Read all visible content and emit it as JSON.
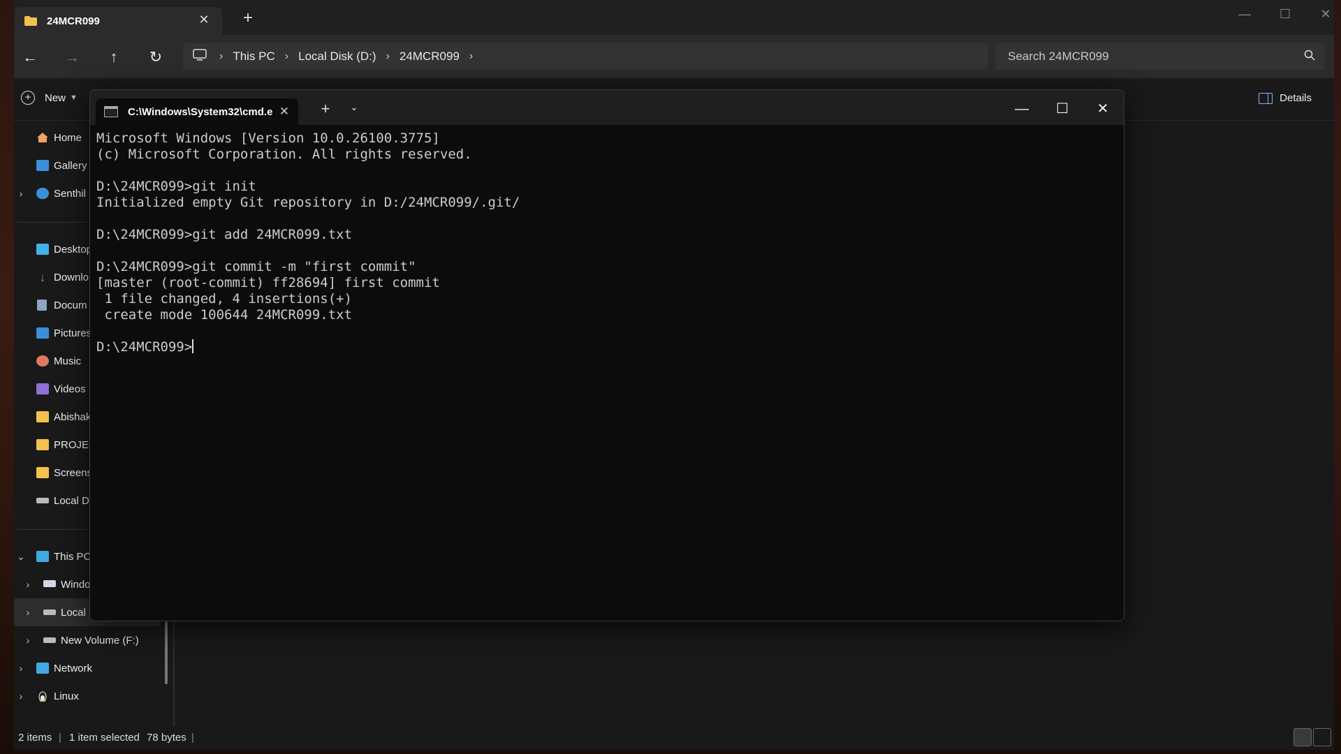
{
  "explorer": {
    "tab_title": "24MCR099",
    "breadcrumb": [
      "This PC",
      "Local Disk (D:)",
      "24MCR099"
    ],
    "search_placeholder": "Search 24MCR099",
    "new_label": "New",
    "details_label": "Details",
    "sidebar": {
      "home": "Home",
      "gallery": "Gallery",
      "onedrive": "Senthil",
      "desktop": "Desktop",
      "downloads": "Downlo",
      "documents": "Docum",
      "pictures": "Pictures",
      "music": "Music",
      "videos": "Videos",
      "abishak": "Abishak",
      "projects": "PROJEC",
      "screenshots": "Screens",
      "local_disk": "Local D",
      "this_pc": "This PC",
      "windows": "Windo",
      "local": "Local",
      "new_volume": "New Volume (F:)",
      "network": "Network",
      "linux": "Linux"
    },
    "status": {
      "items": "2 items",
      "selected": "1 item selected",
      "size": "78 bytes"
    }
  },
  "terminal": {
    "tab_title": "C:\\Windows\\System32\\cmd.e",
    "lines": [
      "Microsoft Windows [Version 10.0.26100.3775]",
      "(c) Microsoft Corporation. All rights reserved.",
      "",
      "D:\\24MCR099>git init",
      "Initialized empty Git repository in D:/24MCR099/.git/",
      "",
      "D:\\24MCR099>git add 24MCR099.txt",
      "",
      "D:\\24MCR099>git commit -m \"first commit\"",
      "[master (root-commit) ff28694] first commit",
      " 1 file changed, 4 insertions(+)",
      " create mode 100644 24MCR099.txt",
      ""
    ],
    "prompt": "D:\\24MCR099>"
  },
  "colors": {
    "folder": "#f2c14e",
    "accent": "#8ab4ff",
    "terminal_bg": "#0c0c0c",
    "explorer_bg": "#191919"
  }
}
